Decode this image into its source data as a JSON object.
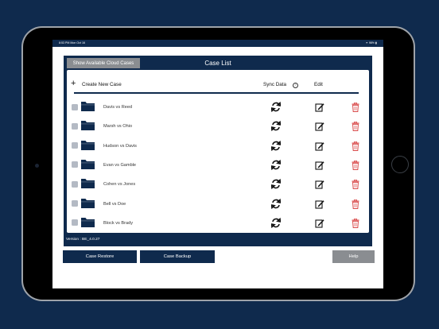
{
  "status_bar": {
    "time": "8:53 PM",
    "date": "Mon Oct 16",
    "battery": "98%"
  },
  "panel": {
    "cloud_button": "Show Available Cloud Cases",
    "title": "Case List"
  },
  "list_header": {
    "create_label": "Create New Case",
    "sync_label": "Sync Data",
    "help_glyph": "?",
    "edit_label": "Edit"
  },
  "cases": [
    {
      "name": "Davis vs Reed"
    },
    {
      "name": "Marsh vs Ohio"
    },
    {
      "name": "Hudson vs Davis"
    },
    {
      "name": "Evan vs Gamble"
    },
    {
      "name": "Cohen vs Jones"
    },
    {
      "name": "Bell vs Doe"
    },
    {
      "name": "Block vs Brady"
    }
  ],
  "version": "Version : BE_4.0.27",
  "buttons": {
    "restore": "Case Restore",
    "backup": "Case Backup",
    "help": "Help"
  },
  "colors": {
    "navy": "#0f2a4d",
    "gray_button": "#8a8d91",
    "checkbox": "#b4bac4",
    "trash_red": "#d94a4a"
  },
  "icons": {
    "create": "plus-icon",
    "sync": "sync-icon",
    "edit": "edit-icon",
    "delete": "trash-icon",
    "folder": "folder-icon"
  }
}
